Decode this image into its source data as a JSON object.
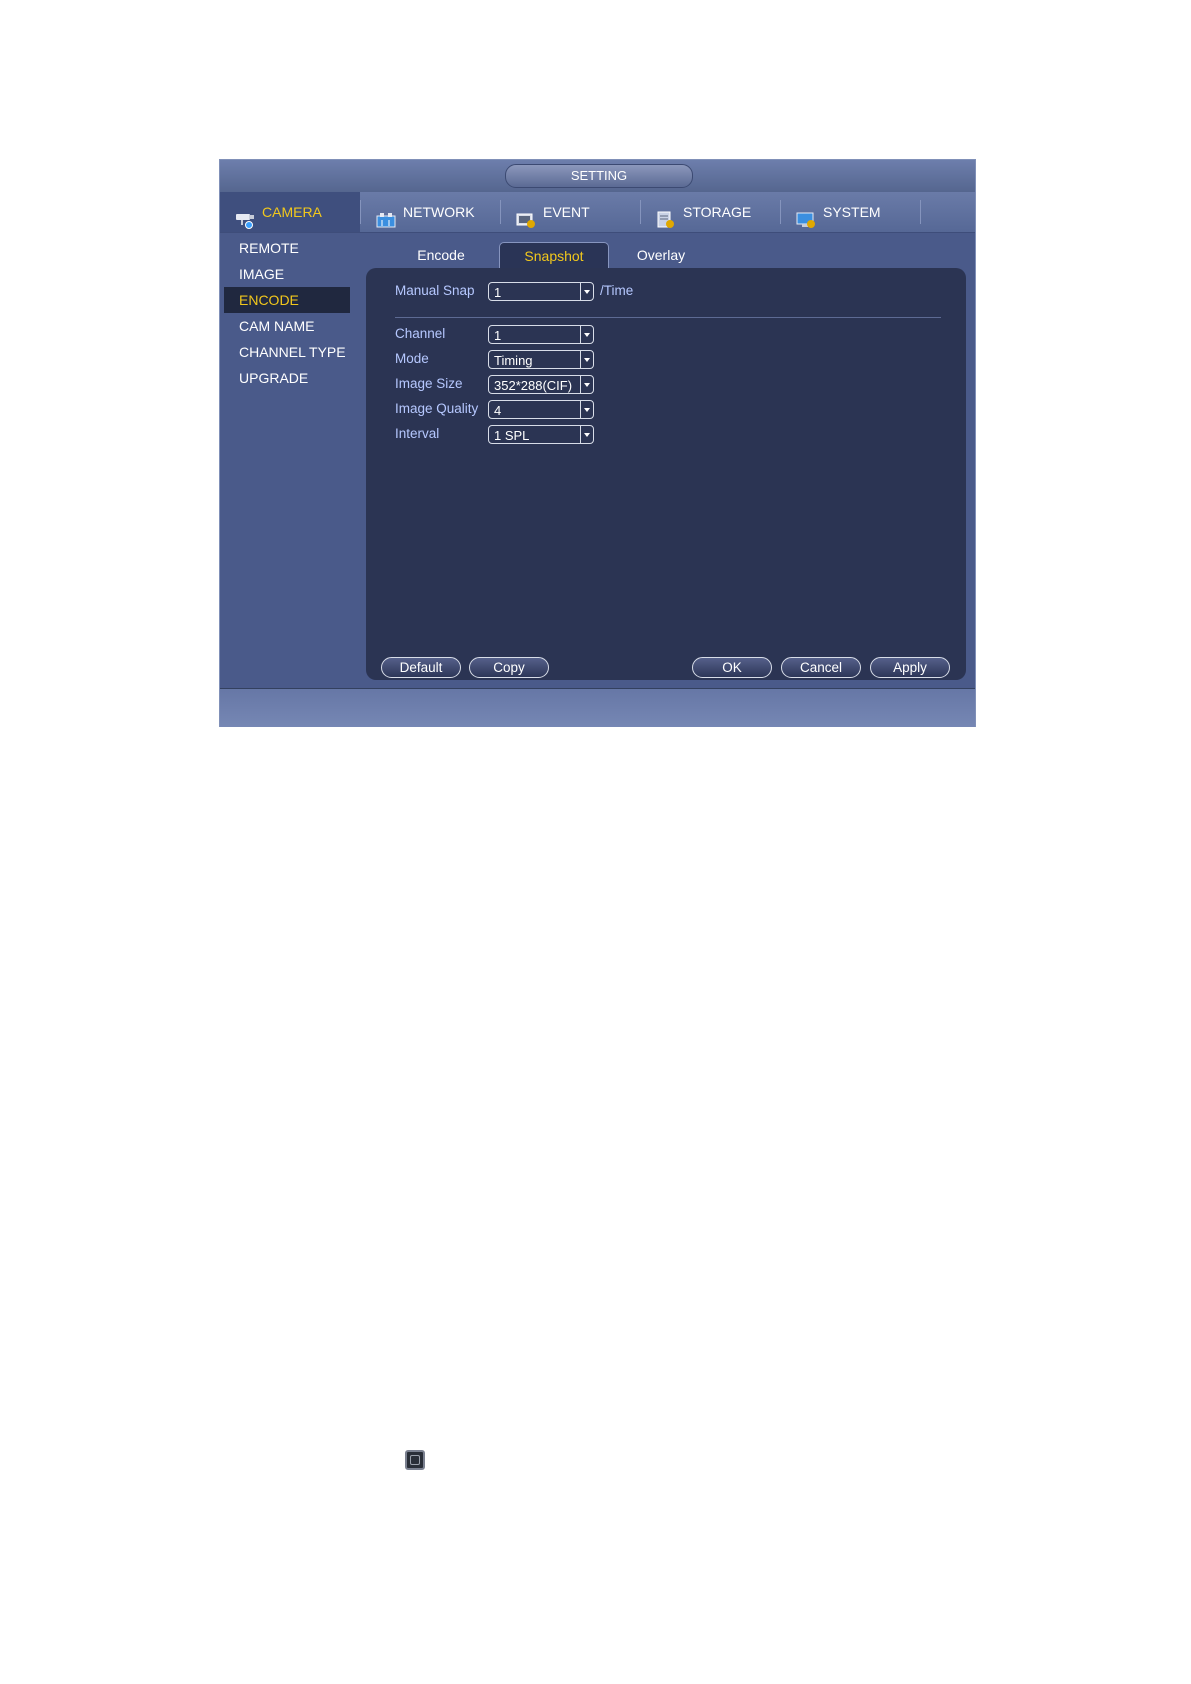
{
  "window": {
    "title": "SETTING"
  },
  "topnav": [
    {
      "label": "CAMERA",
      "icon": "camera-icon",
      "active": true
    },
    {
      "label": "NETWORK",
      "icon": "network-icon",
      "active": false
    },
    {
      "label": "EVENT",
      "icon": "event-icon",
      "active": false
    },
    {
      "label": "STORAGE",
      "icon": "storage-icon",
      "active": false
    },
    {
      "label": "SYSTEM",
      "icon": "system-icon",
      "active": false
    }
  ],
  "sidebar": {
    "items": [
      {
        "label": "REMOTE",
        "active": false
      },
      {
        "label": "IMAGE",
        "active": false
      },
      {
        "label": "ENCODE",
        "active": true
      },
      {
        "label": "CAM NAME",
        "active": false
      },
      {
        "label": "CHANNEL TYPE",
        "active": false
      },
      {
        "label": "UPGRADE",
        "active": false
      }
    ]
  },
  "tabs": [
    {
      "label": "Encode",
      "active": false
    },
    {
      "label": "Snapshot",
      "active": true
    },
    {
      "label": "Overlay",
      "active": false
    }
  ],
  "form": {
    "manual_snap": {
      "label": "Manual Snap",
      "value": "1",
      "suffix": "/Time"
    },
    "channel": {
      "label": "Channel",
      "value": "1"
    },
    "mode": {
      "label": "Mode",
      "value": "Timing"
    },
    "image_size": {
      "label": "Image Size",
      "value": "352*288(CIF)"
    },
    "image_quality": {
      "label": "Image Quality",
      "value": "4"
    },
    "interval": {
      "label": "Interval",
      "value": "1 SPL"
    }
  },
  "buttons": {
    "default": "Default",
    "copy": "Copy",
    "ok": "OK",
    "cancel": "Cancel",
    "apply": "Apply"
  },
  "colors": {
    "accent": "#f2c81c",
    "window_bg": "#4a5a8a",
    "panel_bg": "#2b3453",
    "label": "#b6c8ff"
  }
}
